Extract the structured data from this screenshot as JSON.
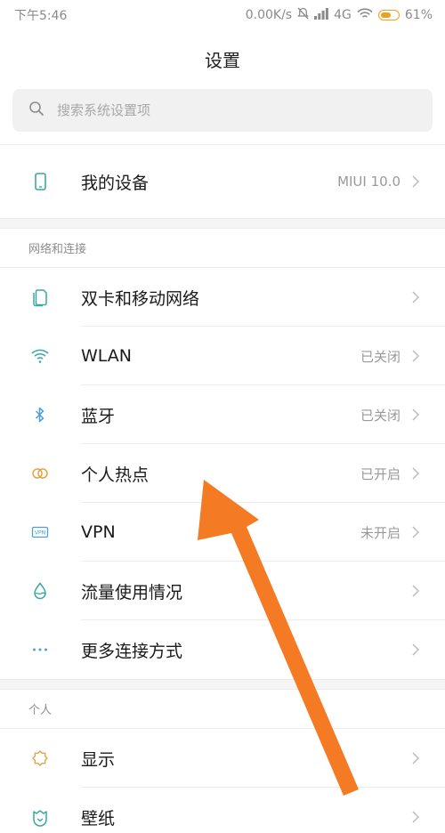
{
  "status_bar": {
    "time": "下午5:46",
    "net_speed": "0.00K/s",
    "network": "4G",
    "battery": "61%"
  },
  "header": {
    "title": "设置"
  },
  "search": {
    "placeholder": "搜索系统设置项"
  },
  "device": {
    "label": "我的设备",
    "value": "MIUI 10.0",
    "icon": "phone-icon"
  },
  "network_section": {
    "header": "网络和连接",
    "items": [
      {
        "label": "双卡和移动网络",
        "value": "",
        "icon": "sim-card-icon"
      },
      {
        "label": "WLAN",
        "value": "已关闭",
        "icon": "wifi-icon"
      },
      {
        "label": "蓝牙",
        "value": "已关闭",
        "icon": "bluetooth-icon"
      },
      {
        "label": "个人热点",
        "value": "已开启",
        "icon": "hotspot-icon"
      },
      {
        "label": "VPN",
        "value": "未开启",
        "icon": "vpn-icon"
      },
      {
        "label": "流量使用情况",
        "value": "",
        "icon": "data-usage-icon"
      },
      {
        "label": "更多连接方式",
        "value": "",
        "icon": "more-dots-icon"
      }
    ]
  },
  "personal_section": {
    "header": "个人",
    "items": [
      {
        "label": "显示",
        "value": "",
        "icon": "display-icon"
      },
      {
        "label": "壁纸",
        "value": "",
        "icon": "wallpaper-icon"
      }
    ]
  },
  "colors": {
    "icon_teal": "#3aa9a1",
    "icon_blue": "#4d9fdc",
    "icon_orange": "#e4a24a",
    "arrow": "#f47a24"
  }
}
